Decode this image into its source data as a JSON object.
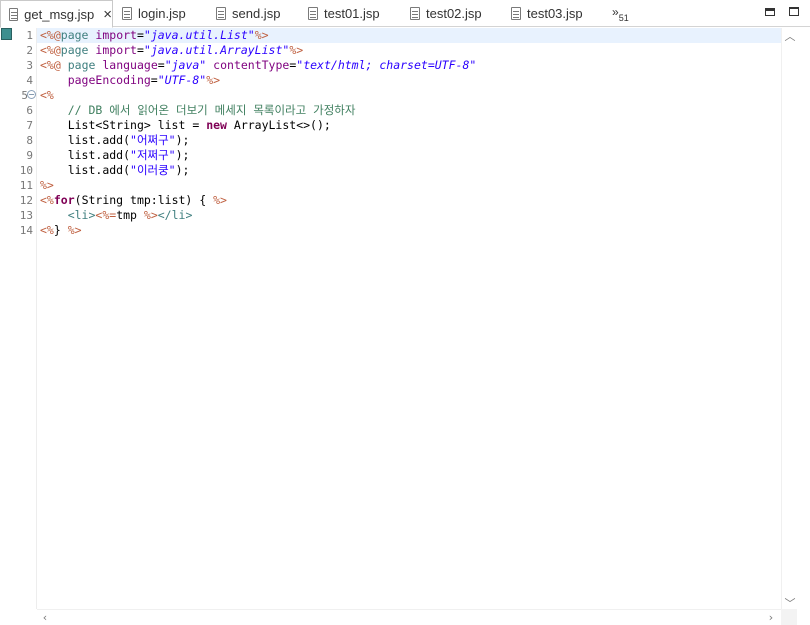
{
  "tabs": [
    {
      "label": "get_msg.jsp",
      "active": true
    },
    {
      "label": "login.jsp"
    },
    {
      "label": "send.jsp"
    },
    {
      "label": "test01.jsp"
    },
    {
      "label": "test02.jsp"
    },
    {
      "label": "test03.jsp"
    }
  ],
  "tab_overflow": {
    "glyph": "»",
    "count": "51"
  },
  "line_numbers": [
    "1",
    "2",
    "3",
    "4",
    "5",
    "6",
    "7",
    "8",
    "9",
    "10",
    "11",
    "12",
    "13",
    "14"
  ],
  "code": {
    "l1": {
      "open": "<%@",
      "kw": "page",
      "sp": " ",
      "attr": "import",
      "eq": "=",
      "val": "\"java.util.List\"",
      "close": "%>"
    },
    "l2": {
      "open": "<%@",
      "kw": "page",
      "sp": " ",
      "attr": "import",
      "eq": "=",
      "val": "\"java.util.ArrayList\"",
      "close": "%>"
    },
    "l3": {
      "open": "<%@",
      "sp0": " ",
      "kw": "page",
      "sp": " ",
      "attr1": "language",
      "eq1": "=",
      "val1": "\"java\"",
      "sp2": " ",
      "attr2": "contentType",
      "eq2": "=",
      "val2": "\"text/html; charset=UTF-8\""
    },
    "l4": {
      "indent": "    ",
      "attr": "pageEncoding",
      "eq": "=",
      "val": "\"UTF-8\"",
      "close": "%>"
    },
    "l5": {
      "open": "<%"
    },
    "l6": {
      "indent": "    ",
      "comment": "// DB 에서 읽어온 더보기 메세지 목록이라고 가정하자"
    },
    "l7": {
      "indent": "    ",
      "pre": "List<String> list = ",
      "kw": "new",
      "post": " ArrayList<>();"
    },
    "l8": {
      "indent": "    ",
      "pre": "list.add(",
      "str": "\"어쩌구\"",
      "post": ");"
    },
    "l9": {
      "indent": "    ",
      "pre": "list.add(",
      "str": "\"저쩌구\"",
      "post": ");"
    },
    "l10": {
      "indent": "    ",
      "pre": "list.add(",
      "str": "\"이러쿵\"",
      "post": ");"
    },
    "l11": {
      "close": "%>"
    },
    "l12": {
      "open": "<%",
      "kw": "for",
      "body": "(String tmp:list) { ",
      "close": "%>"
    },
    "l13": {
      "indent": "    ",
      "li_open": "<li>",
      "expr_open": "<%=",
      "expr": "tmp ",
      "expr_close": "%>",
      "li_close": "</li>"
    },
    "l14": {
      "open": "<%",
      "body": "} ",
      "close": "%>"
    }
  },
  "icons": {
    "file": "jsp-file-icon",
    "close": "close-icon",
    "minimize": "minimize-icon",
    "maximize": "maximize-icon",
    "fold": "fold-collapse-icon",
    "scroll_up": "scroll-up-arrow-icon",
    "scroll_down": "scroll-down-arrow-icon",
    "scroll_left": "scroll-left-arrow-icon",
    "scroll_right": "scroll-right-arrow-icon"
  },
  "colors": {
    "jsp_tag": "#bf5f3f",
    "keyword": "#3f7f7f",
    "attribute": "#7f007f",
    "string": "#2a00ff",
    "java_keyword": "#7f0055",
    "comment": "#3f7f5f",
    "current_line": "#e8f2fe"
  }
}
